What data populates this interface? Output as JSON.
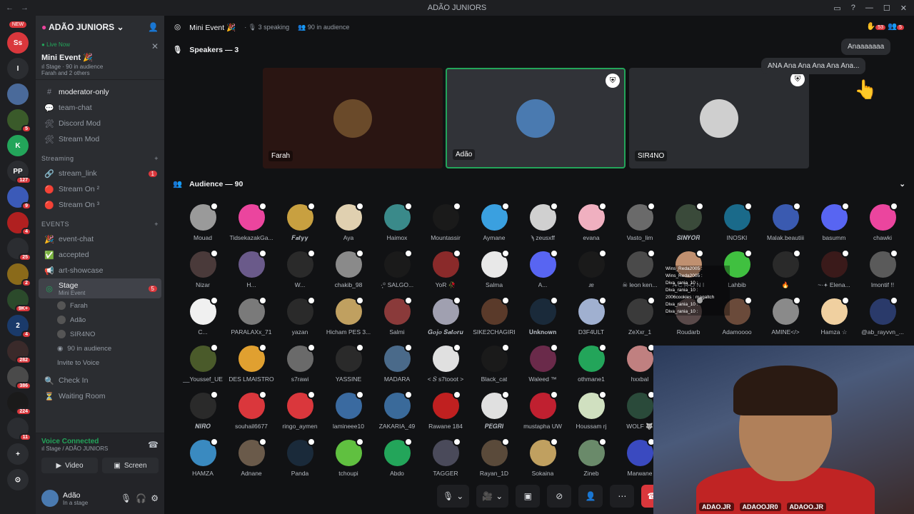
{
  "titlebar": {
    "title": "ADÃO JUNIORS"
  },
  "guilds": [
    {
      "label": "NEW",
      "badge": "",
      "color": "#da373c",
      "text": "Ss"
    },
    {
      "label": "",
      "badge": "",
      "color": "#2b2d31",
      "text": "I"
    },
    {
      "label": "",
      "badge": "",
      "color": "#4a6a9a",
      "text": ""
    },
    {
      "label": "",
      "badge": "5",
      "color": "#3a5a2a",
      "text": ""
    },
    {
      "label": "",
      "badge": "",
      "color": "#23a55a",
      "text": "K"
    },
    {
      "label": "",
      "badge": "127",
      "color": "#2b2d31",
      "text": "PP"
    },
    {
      "label": "",
      "badge": "9",
      "color": "#3b5ab8",
      "text": ""
    },
    {
      "label": "",
      "badge": "4",
      "color": "#b02020",
      "text": ""
    },
    {
      "label": "",
      "badge": "25",
      "color": "#2b2d31",
      "text": ""
    },
    {
      "label": "",
      "badge": "2",
      "color": "#8a6a1a",
      "text": ""
    },
    {
      "label": "",
      "badge": "9K+",
      "color": "#2b4a2b",
      "text": ""
    },
    {
      "label": "",
      "badge": "4",
      "color": "#1a3a6a",
      "text": "2"
    },
    {
      "label": "",
      "badge": "282",
      "color": "#3a2a2a",
      "text": ""
    },
    {
      "label": "",
      "badge": "386",
      "color": "#4a4a4a",
      "text": ""
    },
    {
      "label": "",
      "badge": "224",
      "color": "#1a1a1a",
      "text": ""
    },
    {
      "label": "",
      "badge": "11",
      "color": "#2b2d31",
      "text": ""
    }
  ],
  "sidebar": {
    "server_name": "ADÃO JUNIORS",
    "live": {
      "tag": "Live Now",
      "event": "Mini Event 🎉",
      "meta": "ıl Stage · 90 in audience",
      "people": "Farah and 2 others"
    },
    "channels_top": [
      {
        "icon": "#",
        "label": "moderator-only",
        "white": true
      },
      {
        "icon": "💬",
        "label": "team-chat",
        "white": false
      },
      {
        "icon": "🛠",
        "label": "Discord Mod",
        "white": false
      },
      {
        "icon": "🛠",
        "label": "Stream Mod",
        "white": false
      }
    ],
    "streaming_label": "Streaming",
    "streaming": [
      {
        "icon": "🔗",
        "label": "stream_link",
        "badge": "1"
      },
      {
        "icon": "🔴",
        "label": "Stream On ²",
        "badge": ""
      },
      {
        "icon": "🔴",
        "label": "Stream On ³",
        "badge": ""
      }
    ],
    "events_label": "EVENTS",
    "events": [
      {
        "icon": "🎉",
        "label": "event-chat"
      },
      {
        "icon": "✅",
        "label": "accepted"
      },
      {
        "icon": "📢",
        "label": "art-showcase"
      }
    ],
    "stage": {
      "label": "Stage",
      "sub": "Mini Event",
      "badge": "5"
    },
    "stage_users": [
      "Farah",
      "Adão",
      "SIR4NO"
    ],
    "stage_audience": "90 in audience",
    "invite": "Invite to Voice",
    "after": [
      {
        "icon": "🔍",
        "label": "Check In"
      },
      {
        "icon": "⏳",
        "label": "Waiting Room"
      }
    ],
    "voice": {
      "status": "Voice Connected",
      "where": "ıl Stage / ADÃO JUNIORS",
      "video": "Video",
      "screen": "Screen"
    },
    "user": {
      "name": "Adão",
      "status": "In a stage"
    }
  },
  "main": {
    "header_title": "Mini Event 🎉",
    "speaking": "3 speaking",
    "audience_count": "90 in audience",
    "notif_badge": "53",
    "notif_badge2": "5",
    "speakers_label": "Speakers — 3",
    "speakers": [
      {
        "name": "Farah",
        "bg": "#2a1512",
        "avatar": "#6a4a2a",
        "mod": false
      },
      {
        "name": "Adão",
        "bg": "#313338",
        "avatar": "#4a7ab0",
        "mod": true
      },
      {
        "name": "SIR4NO",
        "bg": "#2b2d31",
        "avatar": "#cfcfcf",
        "mod": true
      }
    ],
    "audience_label": "Audience — 90",
    "bubbles": [
      "Anaaaaaaa",
      "ANA Ana Ana Ana Ana Ana..."
    ],
    "audience": [
      {
        "n": "Mouad",
        "c": "#9a9a9a"
      },
      {
        "n": "TidsekazakGa...",
        "c": "#eb459e"
      },
      {
        "n": "𝑭𝒂𝒕𝒚𝒚",
        "c": "#c8a040"
      },
      {
        "n": "Aya",
        "c": "#e0d0b0"
      },
      {
        "n": "Haimox",
        "c": "#3a8a8a"
      },
      {
        "n": "Mountassir",
        "c": "#1a1a1a"
      },
      {
        "n": "Aymane",
        "c": "#3aa0e0"
      },
      {
        "n": "ϡ zeusxff",
        "c": "#d0d0d0"
      },
      {
        "n": "evana",
        "c": "#f0b0c0"
      },
      {
        "n": "Vasto_lim",
        "c": "#6a6a6a"
      },
      {
        "n": "𝑺𝑰𝑵𝒀𝑶𝑹",
        "c": "#3a4a3a"
      },
      {
        "n": "INOSKI",
        "c": "#1a6a8a"
      },
      {
        "n": "Malak.beautiii",
        "c": "#3a5ab0"
      },
      {
        "n": "basumm",
        "c": "#5865f2"
      },
      {
        "n": "chawki",
        "c": "#eb459e"
      },
      {
        "n": "Nizar",
        "c": "#4a3a3a"
      },
      {
        "n": "H...",
        "c": "#6a5a8a"
      },
      {
        "n": "W...",
        "c": "#2a2a2a"
      },
      {
        "n": "chakib_98",
        "c": "#8a8a8a"
      },
      {
        "n": "·̩͙꙳ SALGO...",
        "c": "#1a1a1a"
      },
      {
        "n": "YoR 🥀",
        "c": "#8a2a2a"
      },
      {
        "n": "Salma",
        "c": "#e8e8e8"
      },
      {
        "n": "A...",
        "c": "#5865f2"
      },
      {
        "n": "ɹɐ",
        "c": "#1a1a1a"
      },
      {
        "n": "☠ leon ken...",
        "c": "#4a4a4a"
      },
      {
        "n": "A C R O N I",
        "c": "#c09070"
      },
      {
        "n": "Lahbib",
        "c": "#40c040"
      },
      {
        "n": "🔥",
        "c": "#2a2a2a"
      },
      {
        "n": "~·𖥔 Elena...",
        "c": "#3a1a1a"
      },
      {
        "n": "lmontif !!",
        "c": "#5a5a5a"
      },
      {
        "n": "C...",
        "c": "#f0f0f0"
      },
      {
        "n": "PARALAXx_71",
        "c": "#7a7a7a"
      },
      {
        "n": "yazan",
        "c": "#2a2a2a"
      },
      {
        "n": "Hicham PES 3...",
        "c": "#c0a060"
      },
      {
        "n": "Salmi",
        "c": "#8a3a3a"
      },
      {
        "n": "𝑮𝒐𝒋𝒐 𝑺𝒂𝒕𝒐𝒓𝒖",
        "c": "#a0a0b0"
      },
      {
        "n": "SIKE2CHAGIRI",
        "c": "#5a3a2a"
      },
      {
        "n": "𝐔𝐧𝐤𝐧𝐨𝐰𝐧",
        "c": "#1a2a3a"
      },
      {
        "n": "D3F4ULT",
        "c": "#a0b0d0"
      },
      {
        "n": "ZeXxr_1",
        "c": "#3a3a3a"
      },
      {
        "n": "Roudarb",
        "c": "#5a4a4a"
      },
      {
        "n": "Adamoooo",
        "c": "#6a4a3a"
      },
      {
        "n": "AMINE</>",
        "c": "#8a8a8a"
      },
      {
        "n": "Hamza ☆",
        "c": "#f0d0a0"
      },
      {
        "n": "@ab_rayvvn_...",
        "c": "#2a3a6a"
      },
      {
        "n": "__Youssef_UE",
        "c": "#4a5a2a"
      },
      {
        "n": "DES LMAISTRO",
        "c": "#e0a030"
      },
      {
        "n": "s7rawi",
        "c": "#6a6a6a"
      },
      {
        "n": "YASSINE",
        "c": "#2a2a2a"
      },
      {
        "n": "MADARA",
        "c": "#4a6a8a"
      },
      {
        "n": "< 𝑆 s7tooot >",
        "c": "#e0e0e0"
      },
      {
        "n": "Black_cat",
        "c": "#1a1a1a"
      },
      {
        "n": "Waleed ™",
        "c": "#6a2a4a"
      },
      {
        "n": "othmane1",
        "c": "#23a55a"
      },
      {
        "n": "hxxbal",
        "c": "#c08080"
      },
      {
        "n": "",
        "c": "#111214"
      },
      {
        "n": "",
        "c": "#111214"
      },
      {
        "n": "",
        "c": "#111214"
      },
      {
        "n": "",
        "c": "#111214"
      },
      {
        "n": "",
        "c": "#111214"
      },
      {
        "n": "𝑵𝑰𝑹𝑶",
        "c": "#2a2a2a"
      },
      {
        "n": "souhail6677",
        "c": "#da373c"
      },
      {
        "n": "ringo_aymen",
        "c": "#da373c"
      },
      {
        "n": "lamineee10",
        "c": "#3a6aa0"
      },
      {
        "n": "ZAKARIA_49",
        "c": "#3a6a9a"
      },
      {
        "n": "Rawane 184",
        "c": "#c02020"
      },
      {
        "n": "𝑷𝑬𝑮𝑹𝑰",
        "c": "#e0e0e0"
      },
      {
        "n": "mustapha UW",
        "c": "#c02030"
      },
      {
        "n": "Houssam rj",
        "c": "#d0e0c0"
      },
      {
        "n": "WOLF 🐺",
        "c": "#2a4a3a"
      },
      {
        "n": "",
        "c": "#111214"
      },
      {
        "n": "",
        "c": "#111214"
      },
      {
        "n": "",
        "c": "#111214"
      },
      {
        "n": "",
        "c": "#111214"
      },
      {
        "n": "",
        "c": "#111214"
      },
      {
        "n": "HAMZA",
        "c": "#3a8ac0"
      },
      {
        "n": "Adnane",
        "c": "#6a5a4a"
      },
      {
        "n": "Panda",
        "c": "#1a2a3a"
      },
      {
        "n": "tchoupi",
        "c": "#60c040"
      },
      {
        "n": "Abdo",
        "c": "#23a55a"
      },
      {
        "n": "TAGGER",
        "c": "#4a4a5a"
      },
      {
        "n": "Rayan_1D",
        "c": "#5a4a3a"
      },
      {
        "n": "Sokaina",
        "c": "#c0a060"
      },
      {
        "n": "Zineb",
        "c": "#6a8a6a"
      },
      {
        "n": "Marwane",
        "c": "#3a4ac0"
      },
      {
        "n": "",
        "c": "#111214"
      },
      {
        "n": "",
        "c": "#111214"
      },
      {
        "n": "",
        "c": "#111214"
      },
      {
        "n": "",
        "c": "#111214"
      },
      {
        "n": "",
        "c": "#111214"
      }
    ],
    "chat_overlay": [
      "Wins_Reda2005 :",
      "Wins_Reda2005 :",
      "Diva_rania_10 :",
      "Diva_rania_10 :",
      "2006cookies : magaltch",
      "Diva_rania_10 :",
      "Diva_rania_10 :"
    ],
    "cam_handles": [
      "ADAO.JR",
      "ADAOOJR0",
      "ADAOO.JR"
    ]
  },
  "colors": {
    "accent": "#5865f2",
    "green": "#23a55a",
    "red": "#da373c"
  }
}
